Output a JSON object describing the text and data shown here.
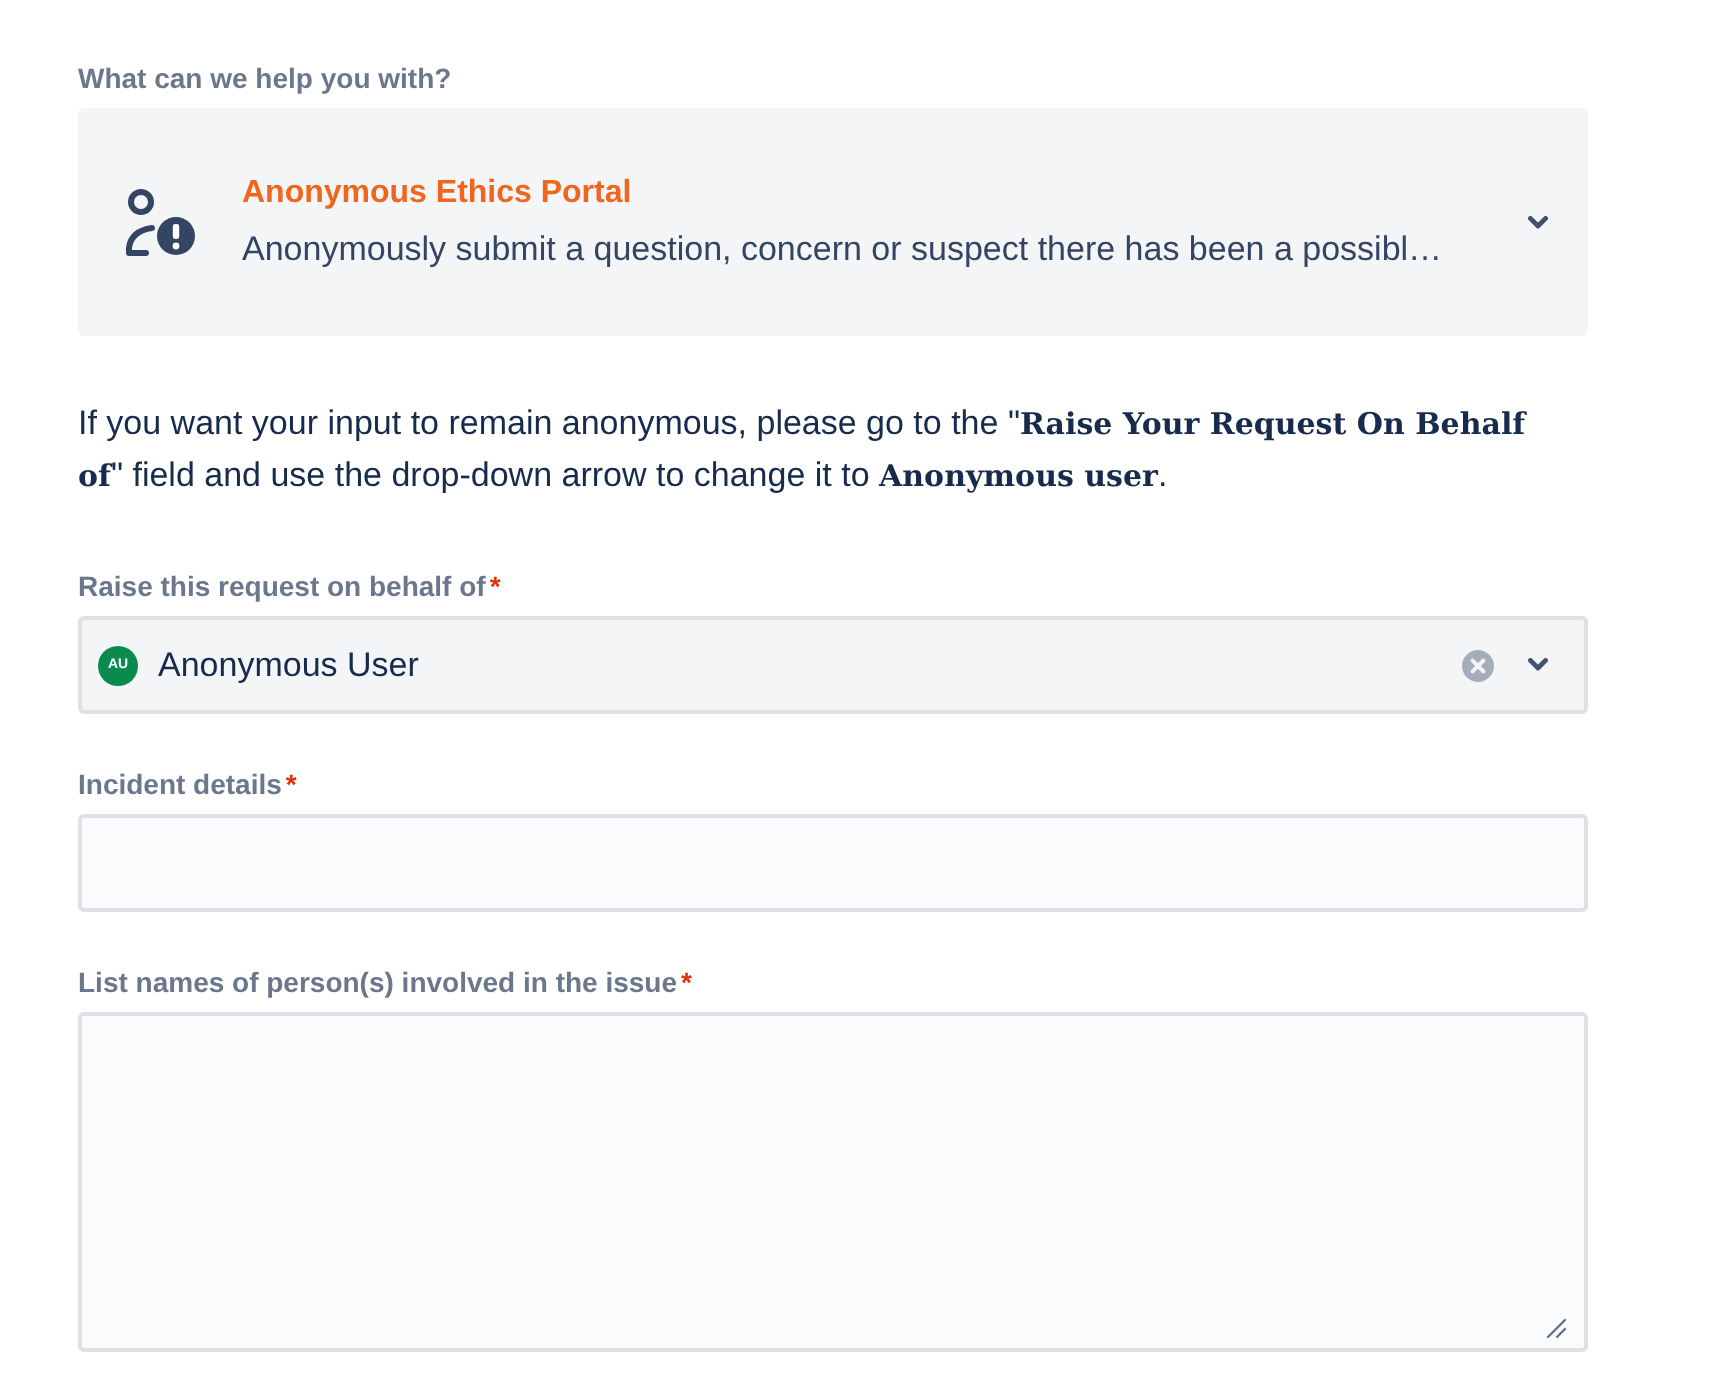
{
  "request_type": {
    "label": "What can we help you with?",
    "title": "Anonymous Ethics Portal",
    "description": "Anonymously submit a question, concern or suspect there has been a possibl…"
  },
  "notice": "If you want your input to remain anonymous, please go to the \"**Raise Your Request On Behalf of**\" field and use the drop-down arrow to change it to **Anonymous user**.",
  "fields": [
    {
      "kind": "select",
      "label": "Raise this request on behalf of",
      "required_mark": "*",
      "avatar": "AU",
      "value": "Anonymous User"
    },
    {
      "kind": "input",
      "label": "Incident details",
      "required_mark": "*"
    },
    {
      "kind": "textarea",
      "label": "List names of person(s) involved in the issue",
      "required_mark": "*"
    }
  ]
}
